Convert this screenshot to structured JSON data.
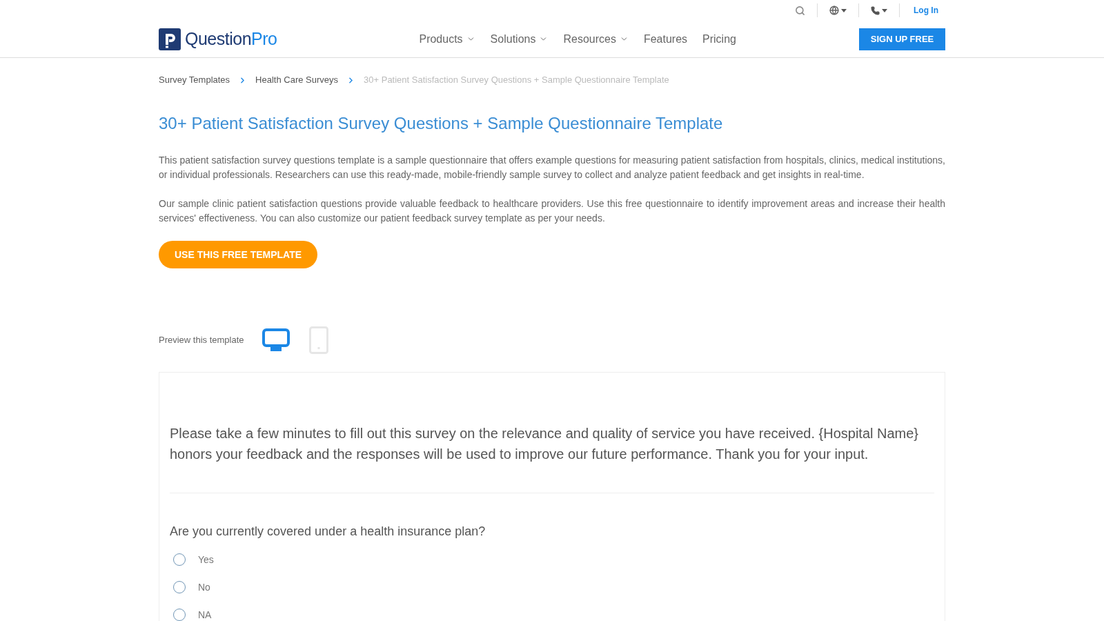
{
  "header": {
    "login": "Log In",
    "logo": {
      "parts": [
        {
          "text": "Question",
          "color": "#1f3b73"
        },
        {
          "text": "Pro",
          "color": "#1b87e6"
        }
      ]
    },
    "nav": [
      {
        "label": "Products",
        "dropdown": true
      },
      {
        "label": "Solutions",
        "dropdown": true
      },
      {
        "label": "Resources",
        "dropdown": true
      },
      {
        "label": "Features",
        "dropdown": false
      },
      {
        "label": "Pricing",
        "dropdown": false
      }
    ],
    "signup": "SIGN UP FREE"
  },
  "breadcrumb": [
    {
      "label": "Survey Templates",
      "current": false
    },
    {
      "label": "Health Care Surveys",
      "current": false
    },
    {
      "label": "30+ Patient Satisfaction Survey Questions + Sample Questionnaire Template",
      "current": true
    }
  ],
  "title": "30+ Patient Satisfaction Survey Questions + Sample Questionnaire Template",
  "paragraphs": [
    "This patient satisfaction survey questions template is a sample questionnaire that offers example questions for measuring patient satisfaction from hospitals, clinics, medical institutions, or individual professionals. Researchers can use this ready-made, mobile-friendly sample survey to collect and analyze patient feedback and get insights in real-time.",
    "Our sample clinic patient satisfaction questions provide valuable feedback to healthcare providers. Use this free questionnaire to identify improvement areas and increase their health services' effectiveness. You can also customize our patient feedback survey template as per your needs."
  ],
  "cta": "USE THIS FREE TEMPLATE",
  "preview": {
    "label": "Preview this template",
    "devices": [
      {
        "kind": "desktop",
        "selected": true
      },
      {
        "kind": "mobile",
        "selected": false
      }
    ]
  },
  "survey": {
    "intro": "Please take a few minutes to fill out this survey on the relevance and quality of service you have received. {Hospital Name} honors your feedback and the responses will be used to improve our future performance. Thank you for your input.",
    "questions": [
      {
        "text": "Are you currently covered under a health insurance plan?",
        "options": [
          {
            "label": "Yes",
            "selected": false
          },
          {
            "label": "No",
            "selected": false
          },
          {
            "label": "NA",
            "selected": false
          }
        ]
      }
    ]
  }
}
